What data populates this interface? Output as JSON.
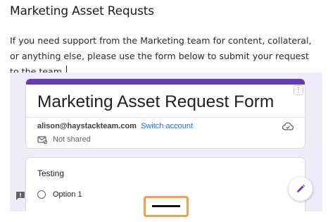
{
  "page": {
    "heading": "Marketing Asset Requsts",
    "intro": "If you need support from the Marketing team for content, collateral, or anything else, please use the form below to submit your request to the team."
  },
  "form": {
    "title": "Marketing Asset Request Form",
    "account_email": "alison@haystackteam.com",
    "switch_account_label": "Switch account",
    "shared_status": "Not shared",
    "accent_color": "#673ab7",
    "question": {
      "title": "Testing",
      "options": [
        "Option 1"
      ]
    }
  },
  "icons": {
    "more": "more-vert-icon",
    "cloud": "cloud-check-icon",
    "shared": "not-shared-icon",
    "edit": "pencil-edit-icon",
    "feedback": "feedback-icon"
  },
  "colors": {
    "embed_background": "#f0ebf8",
    "link": "#1a73e8",
    "fab_icon": "#673ab7",
    "handle_border": "#f0a150"
  }
}
